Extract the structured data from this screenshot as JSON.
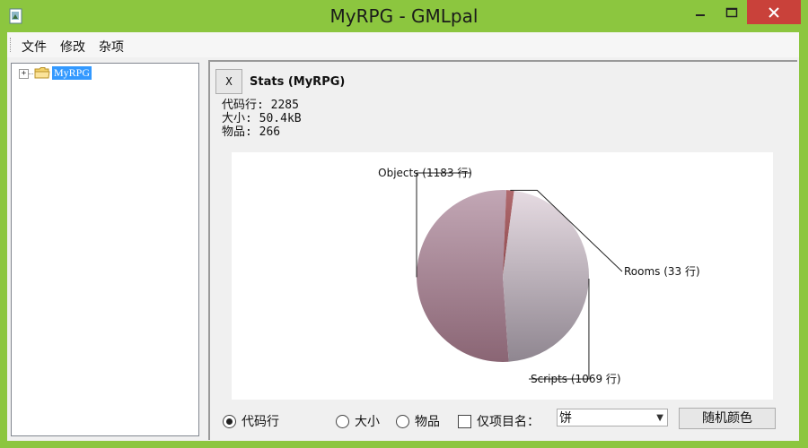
{
  "window": {
    "title": "MyRPG - GMLpal"
  },
  "menu": {
    "items": [
      "文件",
      "修改",
      "杂项"
    ]
  },
  "tree": {
    "root_label": "MyRPG",
    "expander": "+"
  },
  "panel": {
    "close_label": "X",
    "title": "Stats (MyRPG)",
    "stats": [
      "代码行: 2285",
      "大小: 50.4kB",
      "物品: 266"
    ]
  },
  "chart_data": {
    "type": "pie",
    "slices": [
      {
        "label": "Objects (1183 行)",
        "value": 1183,
        "color": "#a8899a"
      },
      {
        "label": "Rooms  (33 行)",
        "value": 33,
        "color": "#a05a5e"
      },
      {
        "label": "Scripts  (1069 行)",
        "value": 1069,
        "color": "#cdbfc9"
      }
    ]
  },
  "controls": {
    "radio_lines": "代码行",
    "radio_size": "大小",
    "radio_items": "物品",
    "checkbox_label": "仅项目名：",
    "select_value": "饼",
    "random_color_button": "随机颜色"
  },
  "colors": {
    "window_frame": "#8cc63f",
    "close_button": "#c9413a",
    "selection": "#3399ff"
  }
}
